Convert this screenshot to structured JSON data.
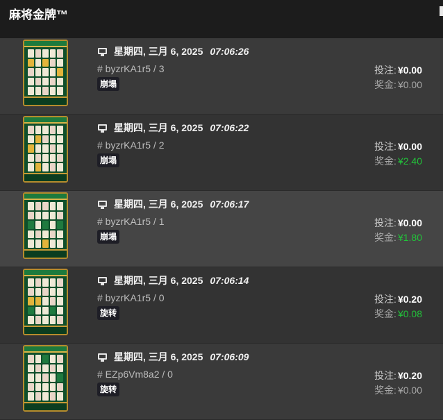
{
  "header": {
    "title": "麻将金牌™"
  },
  "labels": {
    "bet": "投注:",
    "win": "奖金:"
  },
  "colors": {
    "win_positive": "#22c23a",
    "win_zero": "#a8a8a8",
    "badge_bg": "#1e1e26"
  },
  "rows": [
    {
      "date": "星期四, 三月 6, 2025",
      "time": "07:06:26",
      "round": "# byzrKA1r5 / 3",
      "badge": "崩塌",
      "bet": "¥0.00",
      "win": "¥0.00",
      "win_positive": false,
      "device_icon": "monitor-icon"
    },
    {
      "date": "星期四, 三月 6, 2025",
      "time": "07:06:22",
      "round": "# byzrKA1r5 / 2",
      "badge": "崩塌",
      "bet": "¥0.00",
      "win": "¥2.40",
      "win_positive": true,
      "device_icon": "monitor-icon"
    },
    {
      "date": "星期四, 三月 6, 2025",
      "time": "07:06:17",
      "round": "# byzrKA1r5 / 1",
      "badge": "崩塌",
      "bet": "¥0.00",
      "win": "¥1.80",
      "win_positive": true,
      "device_icon": "monitor-icon"
    },
    {
      "date": "星期四, 三月 6, 2025",
      "time": "07:06:14",
      "round": "# byzrKA1r5 / 0",
      "badge": "旋转",
      "bet": "¥0.20",
      "win": "¥0.08",
      "win_positive": true,
      "device_icon": "monitor-icon"
    },
    {
      "date": "星期四, 三月 6, 2025",
      "time": "07:06:09",
      "round": "# EZp6Vm8a2 / 0",
      "badge": "旋转",
      "bet": "¥0.20",
      "win": "¥0.00",
      "win_positive": false,
      "device_icon": "monitor-icon"
    }
  ]
}
